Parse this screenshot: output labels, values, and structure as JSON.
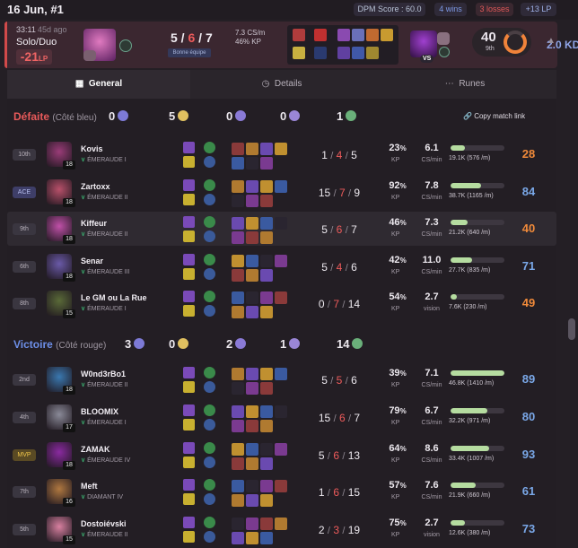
{
  "header": {
    "date": "16 Jun, #1",
    "dpm_score": "DPM Score : 60.0",
    "wins": "4 wins",
    "losses": "3 losses",
    "lp": "+13 LP"
  },
  "summary": {
    "time": "33:11",
    "ago": "45d ago",
    "queue": "Solo/Duo",
    "lp_change": "-21",
    "lp_unit": "LP",
    "kills": "5",
    "deaths": "6",
    "assists": "7",
    "tag": "Bonne équipe",
    "kda_ratio": "2.0 KDA",
    "cs_min": "7.3 CS/m",
    "kp": "46% KP",
    "vs": "VS",
    "score": "40",
    "rank": "9th"
  },
  "tabs": [
    {
      "label": "General",
      "icon": "grid-icon"
    },
    {
      "label": "Details",
      "icon": "clock-icon"
    },
    {
      "label": "Runes",
      "icon": "dots-icon"
    }
  ],
  "teams": [
    {
      "result": "Défaite",
      "side": "(Côté bleu)",
      "color": "#e85a5a",
      "objectives": [
        "0",
        "5",
        "0",
        "0",
        "1"
      ],
      "copy": "Copy match link",
      "players": [
        {
          "badge": "10th",
          "badge_type": "normal",
          "name": "Kovis",
          "rank": "ÉMERAUDE I",
          "level": "18",
          "k": "1",
          "d": "4",
          "a": "5",
          "kp": "23",
          "cs": "6.1",
          "cs_label": "CS/min",
          "dmg": "19.1K (576 /m)",
          "dmg_frac": 0.27,
          "score": "28",
          "score_color": "#f08a3a",
          "champ_color": "#9a3c78",
          "highlight": false
        },
        {
          "badge": "ACE",
          "badge_type": "ace",
          "name": "Zartoxx",
          "rank": "ÉMERAUDE II",
          "level": "18",
          "k": "15",
          "d": "7",
          "a": "9",
          "kp": "92",
          "cs": "7.8",
          "cs_label": "CS/min",
          "dmg": "38.7K (1165 /m)",
          "dmg_frac": 0.56,
          "score": "84",
          "score_color": "#7aa8e8",
          "champ_color": "#b8506a",
          "highlight": false
        },
        {
          "badge": "9th",
          "badge_type": "normal",
          "name": "Kiffeur",
          "rank": "ÉMERAUDE II",
          "level": "18",
          "k": "5",
          "d": "6",
          "a": "7",
          "kp": "46",
          "cs": "7.3",
          "cs_label": "CS/min",
          "dmg": "21.2K (640 /m)",
          "dmg_frac": 0.31,
          "score": "40",
          "score_color": "#f08a3a",
          "champ_color": "#c050a8",
          "highlight": true
        },
        {
          "badge": "6th",
          "badge_type": "normal",
          "name": "Senar",
          "rank": "ÉMERAUDE III",
          "level": "18",
          "k": "5",
          "d": "4",
          "a": "6",
          "kp": "42",
          "cs": "11.0",
          "cs_label": "CS/min",
          "dmg": "27.7K (835 /m)",
          "dmg_frac": 0.4,
          "score": "71",
          "score_color": "#7aa8e8",
          "champ_color": "#6a5aa8",
          "highlight": false
        },
        {
          "badge": "8th",
          "badge_type": "normal",
          "name": "Le GM ou La Rue",
          "rank": "ÉMERAUDE I",
          "level": "15",
          "k": "0",
          "d": "7",
          "a": "14",
          "kp": "54",
          "cs": "2.7",
          "cs_label": "vision",
          "dmg": "7.6K (230 /m)",
          "dmg_frac": 0.11,
          "score": "49",
          "score_color": "#f08a3a",
          "champ_color": "#5a6a38",
          "highlight": false
        }
      ]
    },
    {
      "result": "Victoire",
      "side": "(Côté rouge)",
      "color": "#6d8fe8",
      "objectives": [
        "3",
        "0",
        "2",
        "1",
        "14"
      ],
      "players": [
        {
          "badge": "2nd",
          "badge_type": "normal",
          "name": "W0nd3rBo1",
          "rank": "ÉMERAUDE II",
          "level": "18",
          "k": "5",
          "d": "5",
          "a": "6",
          "kp": "39",
          "cs": "7.1",
          "cs_label": "CS/min",
          "dmg": "46.8K (1410 /m)",
          "dmg_frac": 1.0,
          "score": "89",
          "score_color": "#7aa8e8",
          "champ_color": "#3a78b0",
          "highlight": false
        },
        {
          "badge": "4th",
          "badge_type": "normal",
          "name": "BLOOMIX",
          "rank": "ÉMERAUDE I",
          "level": "17",
          "k": "15",
          "d": "6",
          "a": "7",
          "kp": "79",
          "cs": "6.7",
          "cs_label": "CS/min",
          "dmg": "32.2K (971 /m)",
          "dmg_frac": 0.69,
          "score": "80",
          "score_color": "#7aa8e8",
          "champ_color": "#8a8a98",
          "highlight": false
        },
        {
          "badge": "MVP",
          "badge_type": "mvp",
          "name": "ZAMAK",
          "rank": "ÉMERAUDE IV",
          "level": "18",
          "k": "5",
          "d": "6",
          "a": "13",
          "kp": "64",
          "cs": "8.6",
          "cs_label": "CS/min",
          "dmg": "33.4K (1007 /m)",
          "dmg_frac": 0.71,
          "score": "93",
          "score_color": "#7aa8e8",
          "champ_color": "#8a2aa0",
          "highlight": false
        },
        {
          "badge": "7th",
          "badge_type": "normal",
          "name": "Meft",
          "rank": "DIAMANT IV",
          "level": "16",
          "k": "1",
          "d": "6",
          "a": "15",
          "kp": "57",
          "cs": "7.6",
          "cs_label": "CS/min",
          "dmg": "21.9K (660 /m)",
          "dmg_frac": 0.47,
          "score": "61",
          "score_color": "#7aa8e8",
          "champ_color": "#b07840",
          "highlight": false
        },
        {
          "badge": "5th",
          "badge_type": "normal",
          "name": "Dostoiévski",
          "rank": "ÉMERAUDE II",
          "level": "15",
          "k": "2",
          "d": "3",
          "a": "19",
          "kp": "75",
          "cs": "2.7",
          "cs_label": "vision",
          "dmg": "12.6K (380 /m)",
          "dmg_frac": 0.27,
          "score": "73",
          "score_color": "#7aa8e8",
          "champ_color": "#d880a0",
          "highlight": false
        }
      ]
    }
  ]
}
